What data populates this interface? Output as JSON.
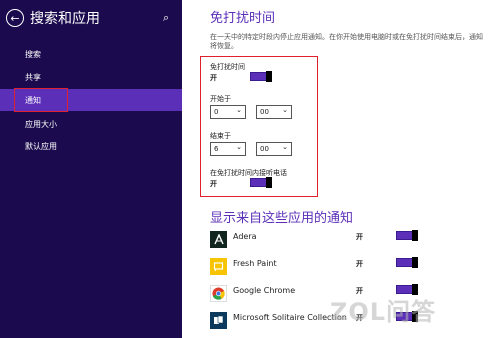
{
  "sidebar": {
    "title": "搜索和应用",
    "items": [
      {
        "label": "搜索"
      },
      {
        "label": "共享"
      },
      {
        "label": "通知",
        "active": true
      },
      {
        "label": "应用大小"
      },
      {
        "label": "默认应用"
      }
    ]
  },
  "quiet_hours": {
    "title": "免打扰时间",
    "description": "在一天中的特定时段内停止应用通知。在你开始使用电脑时或在免打扰时间结束后，通知将恢复。",
    "toggle_label": "免打扰时间",
    "toggle_state": "开",
    "start_label": "开始于",
    "start_hour": "0",
    "start_minute": "00",
    "end_label": "结束于",
    "end_hour": "6",
    "end_minute": "00",
    "calls_label": "在免打扰时间内接听电话",
    "calls_state": "开"
  },
  "apps_section": {
    "title": "显示来自这些应用的通知",
    "apps": [
      {
        "name": "Adera",
        "state": "开"
      },
      {
        "name": "Fresh Paint",
        "state": "开"
      },
      {
        "name": "Google Chrome",
        "state": "开"
      },
      {
        "name": "Microsoft Solitaire Collection",
        "state": "开"
      }
    ]
  },
  "watermark": "ZOL问答",
  "colors": {
    "sidebar_bg": "#1b0b4e",
    "accent": "#5b2fb8",
    "highlight_border": "#e0202a"
  },
  "icons": {
    "back": "back-arrow-icon",
    "search": "search-icon",
    "adera": "adera-app-icon",
    "fresh_paint": "fresh-paint-app-icon",
    "chrome": "chrome-app-icon",
    "solitaire": "solitaire-app-icon"
  }
}
